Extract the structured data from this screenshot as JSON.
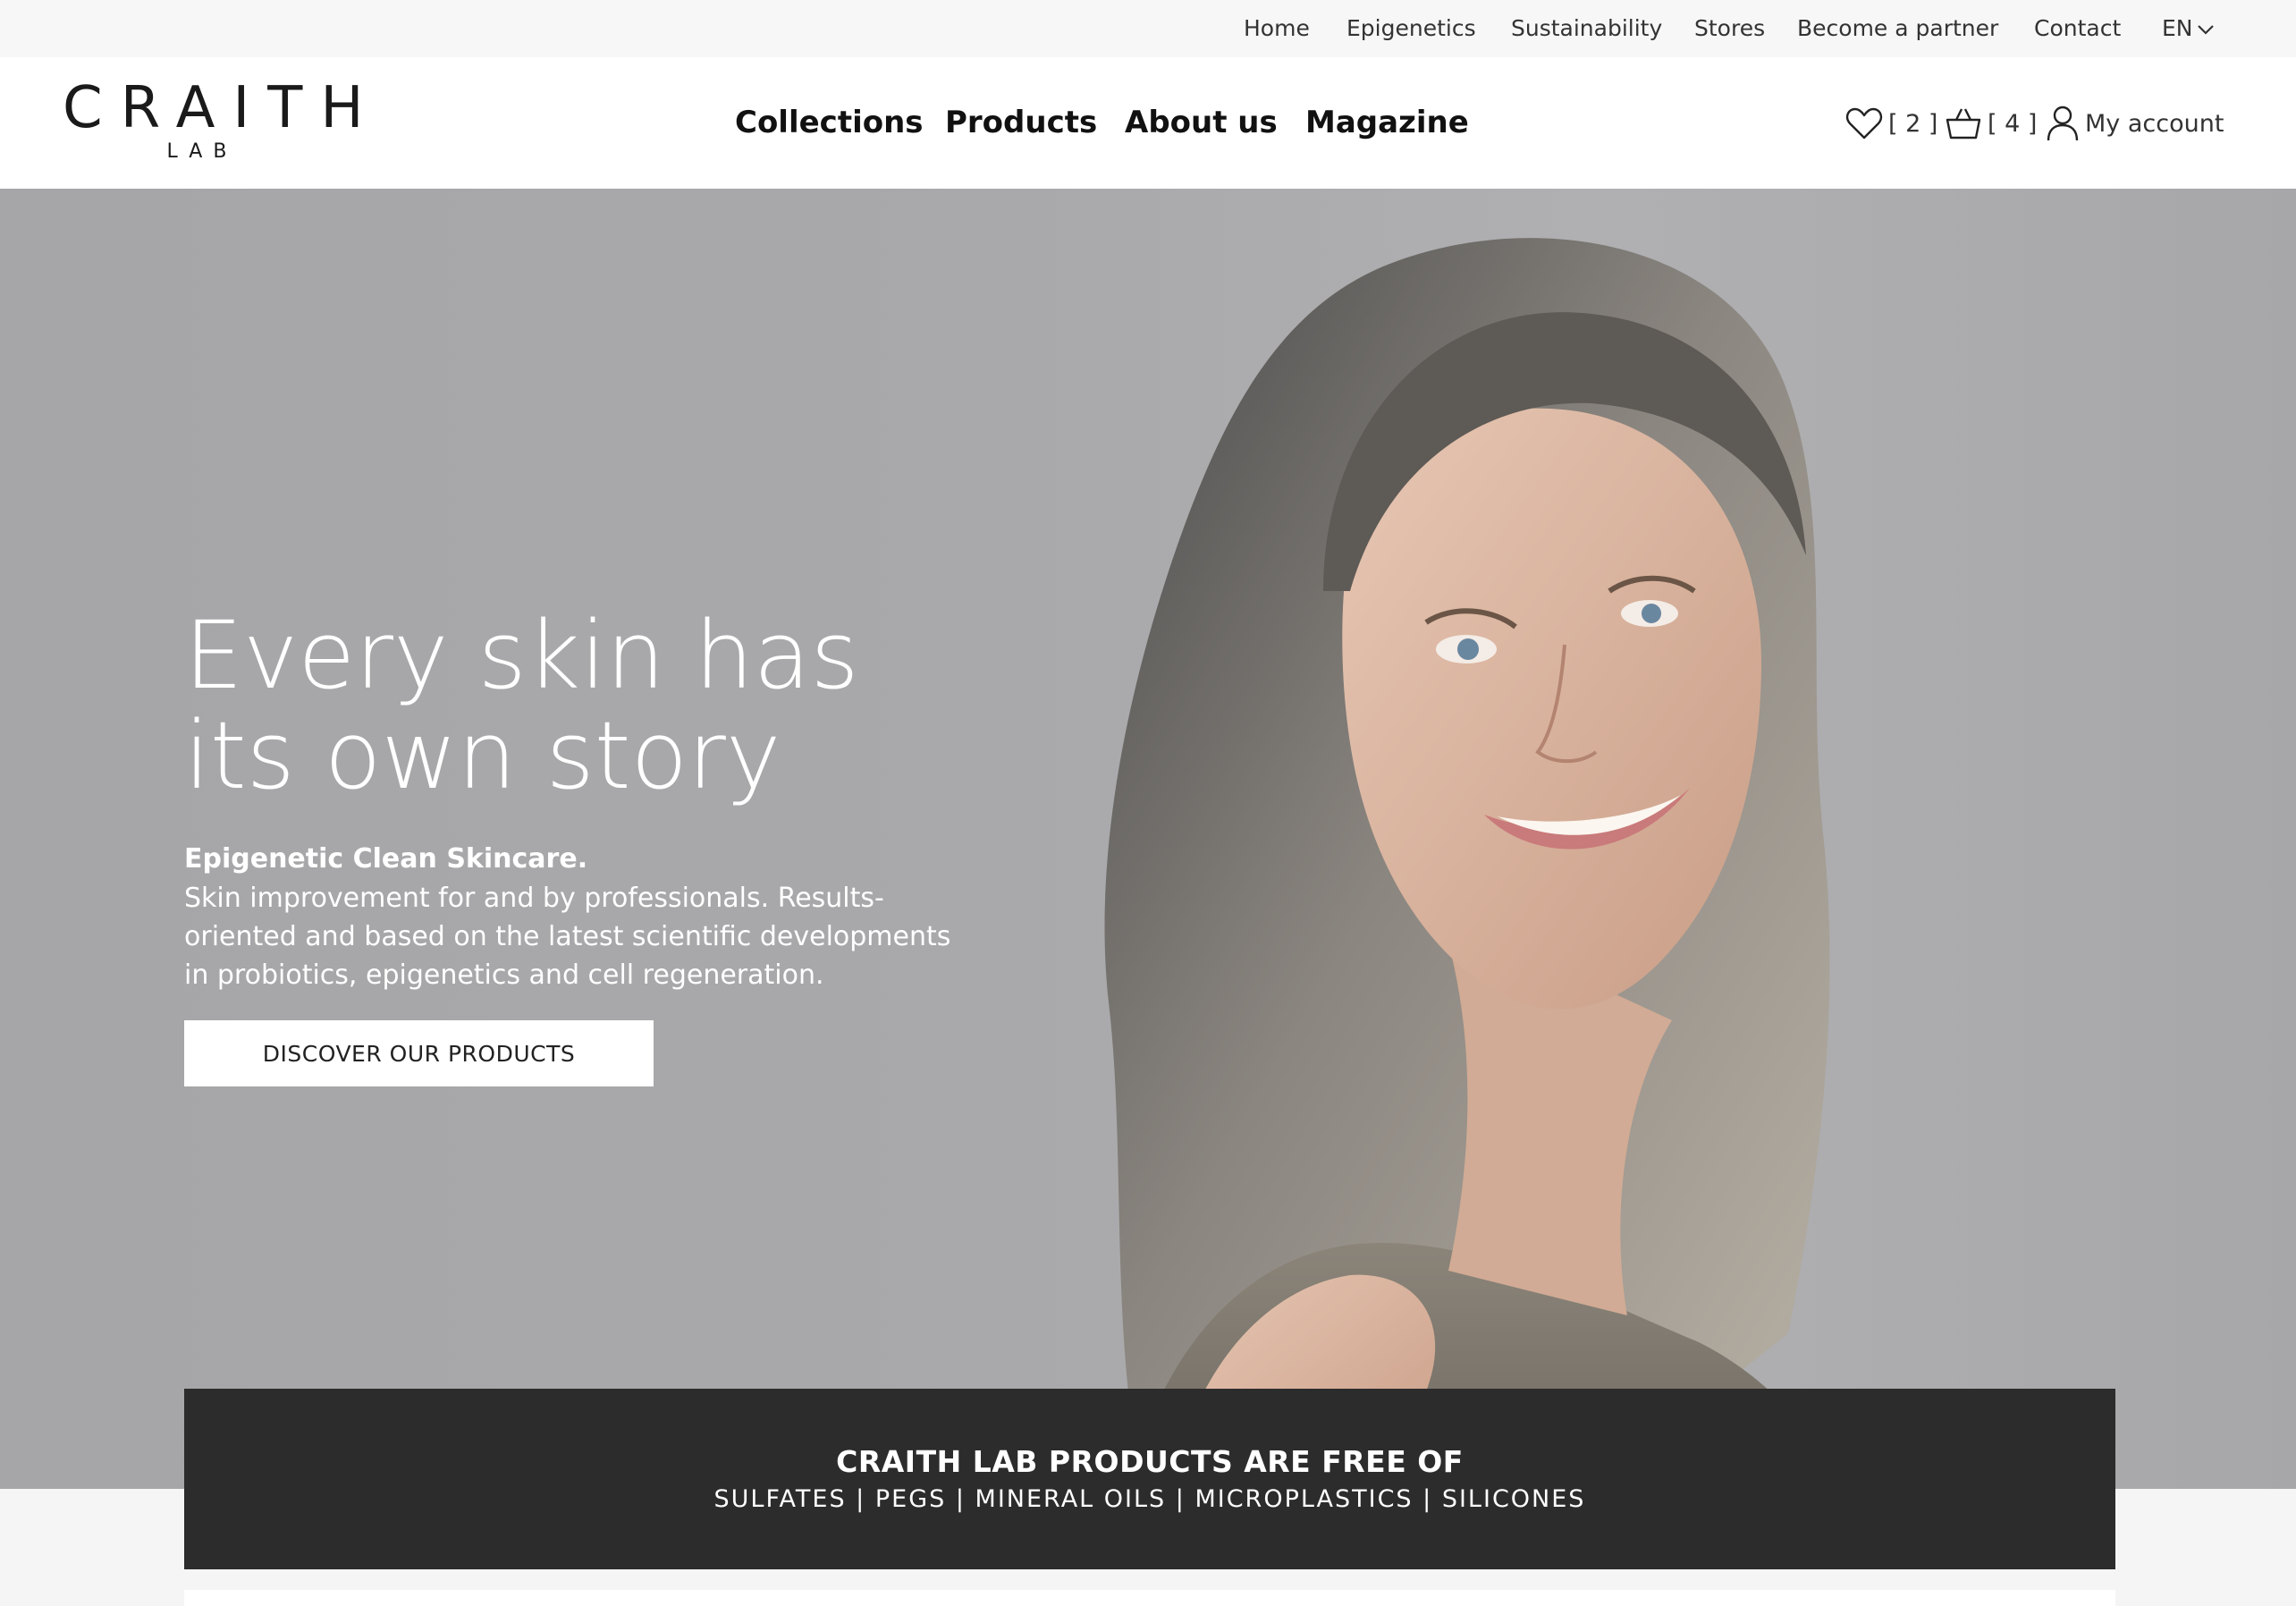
{
  "topbar": {
    "links": [
      "Home",
      "Epigenetics",
      "Sustainability",
      "Stores",
      "Become a partner",
      "Contact"
    ],
    "language": "EN"
  },
  "header": {
    "logo_main": "CRAITH",
    "logo_sub": "LAB",
    "nav": [
      "Collections",
      "Products",
      "About us",
      "Magazine"
    ],
    "wishlist_count": "[ 2 ]",
    "cart_count": "[ 4 ]",
    "account_label": "My account"
  },
  "hero": {
    "title": "Every skin has\nits own story",
    "subtitle": "Epigenetic Clean Skincare.",
    "text": "Skin improvement for and by professionals. Results-oriented and based on the latest scientific developments in probiotics, epigenetics and cell regeneration.",
    "cta_label": "DISCOVER OUR PRODUCTS"
  },
  "free_of": {
    "title": "CRAITH LAB PRODUCTS ARE FREE OF",
    "list": "SULFATES | PEGS | MINERAL OILS | MICROPLASTICS | SILICONES"
  },
  "colors": {
    "hero_bg": "#a9a9ab",
    "banner_bg": "#2c2c2c",
    "topbar_bg": "#f7f7f7"
  }
}
